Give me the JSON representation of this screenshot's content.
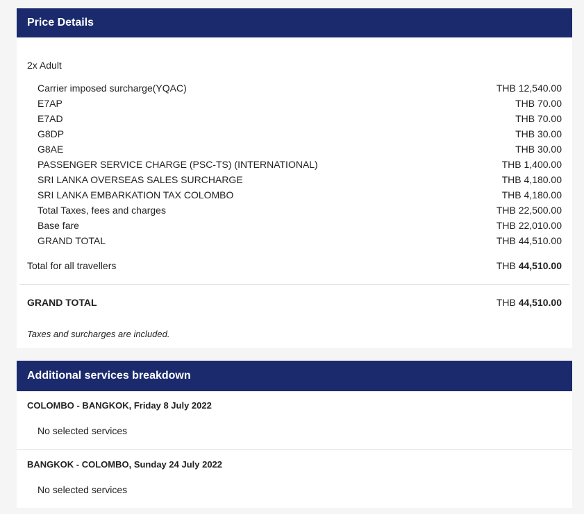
{
  "price_details": {
    "title": "Price Details",
    "pax_label": "2x Adult",
    "items": [
      {
        "label": "Carrier imposed surcharge(YQAC)",
        "amount": "THB 12,540.00"
      },
      {
        "label": "E7AP",
        "amount": "THB 70.00"
      },
      {
        "label": "E7AD",
        "amount": "THB 70.00"
      },
      {
        "label": "G8DP",
        "amount": "THB 30.00"
      },
      {
        "label": "G8AE",
        "amount": "THB 30.00"
      },
      {
        "label": "PASSENGER SERVICE CHARGE (PSC-TS) (INTERNATIONAL)",
        "amount": "THB 1,400.00"
      },
      {
        "label": "SRI LANKA OVERSEAS SALES SURCHARGE",
        "amount": "THB 4,180.00"
      },
      {
        "label": "SRI LANKA EMBARKATION TAX COLOMBO",
        "amount": "THB 4,180.00"
      },
      {
        "label": "Total Taxes, fees and charges",
        "amount": "THB 22,500.00"
      },
      {
        "label": "Base fare",
        "amount": "THB 22,010.00"
      },
      {
        "label": "GRAND TOTAL",
        "amount": "THB 44,510.00"
      }
    ],
    "total_all": {
      "label": "Total for all travellers",
      "currency": "THB",
      "value": "44,510.00"
    },
    "grand_total": {
      "label": "GRAND TOTAL",
      "currency": "THB",
      "value": "44,510.00"
    },
    "note": "Taxes and surcharges are included."
  },
  "additional_services": {
    "title": "Additional services breakdown",
    "segments": [
      {
        "title": "COLOMBO - BANGKOK, Friday 8 July 2022",
        "status": "No selected services"
      },
      {
        "title": "BANGKOK - COLOMBO, Sunday 24 July 2022",
        "status": "No selected services"
      }
    ]
  },
  "colors": {
    "header_bg": "#1a2a6c",
    "page_bg": "#f5f5f5",
    "divider": "#dddddd"
  }
}
